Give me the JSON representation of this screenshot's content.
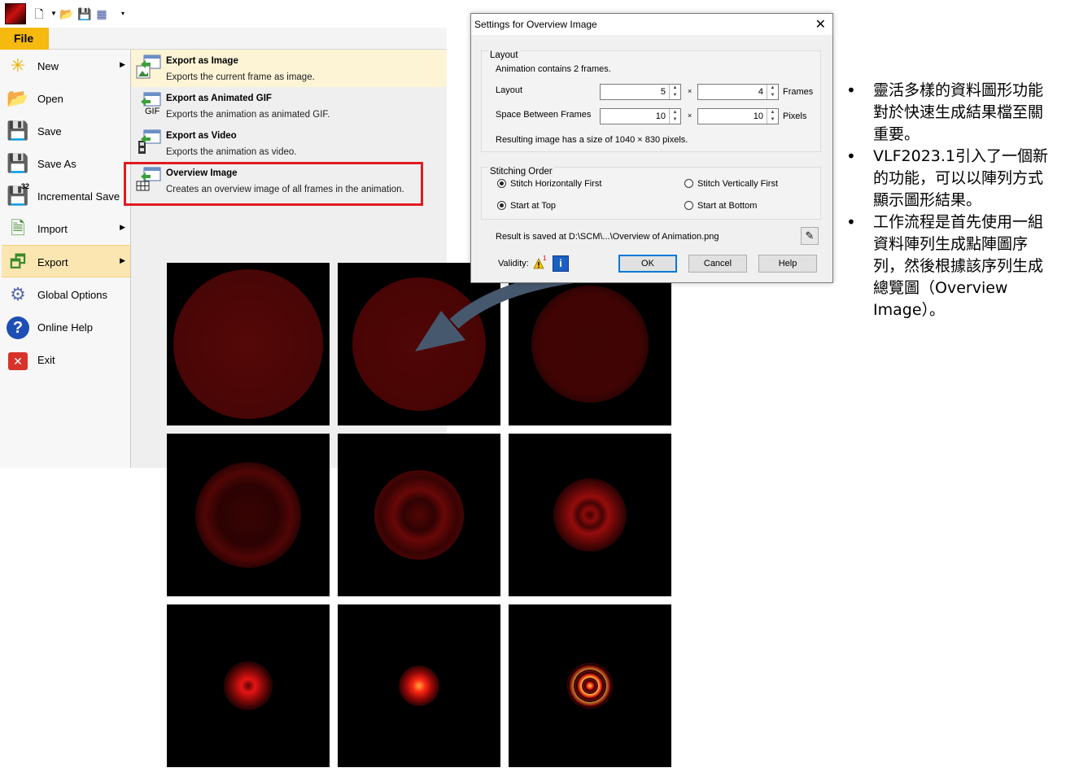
{
  "app": {
    "file_tab": "File",
    "left_menu": [
      {
        "label": "New",
        "icon": "new-icon",
        "has_arrow": true
      },
      {
        "label": "Open",
        "icon": "open-folder-icon",
        "has_arrow": false
      },
      {
        "label": "Save",
        "icon": "save-icon",
        "has_arrow": false
      },
      {
        "label": "Save As",
        "icon": "save-as-icon",
        "has_arrow": false
      },
      {
        "label": "Incremental Save",
        "icon": "incremental-save-icon",
        "has_arrow": false
      },
      {
        "label": "Import",
        "icon": "import-icon",
        "has_arrow": true
      },
      {
        "label": "Export",
        "icon": "export-icon",
        "has_arrow": true,
        "active": true
      },
      {
        "label": "Global Options",
        "icon": "gear-icon",
        "has_arrow": false
      },
      {
        "label": "Online Help",
        "icon": "help-icon",
        "has_arrow": false
      },
      {
        "label": "Exit",
        "icon": "exit-icon",
        "has_arrow": false
      }
    ],
    "incremental_badge": "32",
    "export_submenu": [
      {
        "title": "Export as Image",
        "desc": "Exports the current frame as image.",
        "icon": "export-image-icon"
      },
      {
        "title": "Export as Animated GIF",
        "desc": "Exports the animation as animated GIF.",
        "icon": "export-gif-icon",
        "badge": "GIF"
      },
      {
        "title": "Export as Video",
        "desc": "Exports the animation as video.",
        "icon": "export-video-icon"
      },
      {
        "title": "Overview Image",
        "desc": "Creates an overview image of all frames in the animation.",
        "icon": "overview-image-icon"
      }
    ]
  },
  "dialog": {
    "title": "Settings for Overview Image",
    "layout_group": "Layout",
    "frames_info": "Animation contains 2 frames.",
    "layout_label": "Layout",
    "layout_cols": "5",
    "layout_rows": "4",
    "times": "×",
    "frames_unit": "Frames",
    "spacing_label": "Space Between Frames",
    "spacing_x": "10",
    "spacing_y": "10",
    "pixels_unit": "Pixels",
    "result_size": "Resulting image has a size of 1040 × 830 pixels.",
    "stitching_group": "Stitching Order",
    "opt_horizontal": "Stitch Horizontally First",
    "opt_vertical": "Stitch Vertically First",
    "opt_top": "Start at Top",
    "opt_bottom": "Start at Bottom",
    "saved_path": "Result is saved at D:\\SCM\\...\\Overview of Animation.png",
    "validity_label": "Validity:",
    "validity_count": "1",
    "ok": "OK",
    "cancel": "Cancel",
    "help": "Help"
  },
  "bullets": [
    "靈活多樣的資料圖形功能對於快速生成結果檔至關重要。",
    "VLF2023.1引入了一個新的功能，可以以陣列方式顯示圖形結果。",
    "工作流程是首先使用一組資料陣列生成點陣圖序列，然後根據該序列生成總覽圖（Overview Image）。"
  ]
}
